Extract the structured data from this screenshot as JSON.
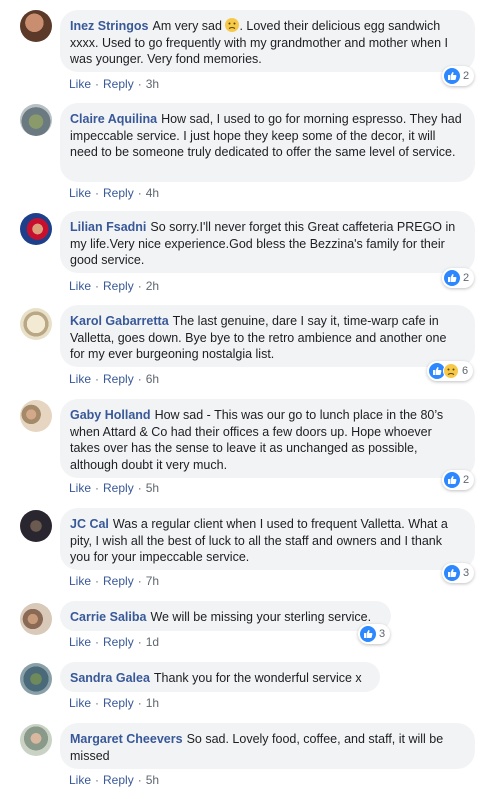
{
  "comments": [
    {
      "author": "Inez Stringos",
      "text": "Am very sad",
      "text_after": ". Loved their delicious egg sandwich xxxx. Used to go frequently with my grandmother and mother when I was younger. Very fond memories.",
      "time": "3h",
      "reaction_count": "2"
    },
    {
      "author": "Claire Aquilina",
      "text": "How sad, I used to go for morning espresso. They had impeccable service. I just hope they keep some of the decor, it will need to be someone truly dedicated to offer the same level of service.",
      "time": "4h"
    },
    {
      "author": "Lilian Fsadni",
      "text": "So sorry.I'll never forget this Great caffeteria PREGO in my life.Very nice experience.God bless the Bezzina's family for their good service.",
      "time": "2h",
      "reaction_count": "2"
    },
    {
      "author": "Karol Gabarretta",
      "text": "The last genuine, dare I say it, time-warp cafe in Valletta, goes down. Bye bye to the retro ambience and another one for my ever burgeoning nostalgia list.",
      "time": "6h",
      "reaction_count": "6"
    },
    {
      "author": "Gaby Holland",
      "text": "How sad - This was our go to lunch place in the 80’s when Attard & Co had their offices a few doors up. Hope whoever takes over has the sense to leave it as unchanged as possible, although doubt it very much.",
      "time": "5h",
      "reaction_count": "2"
    },
    {
      "author": "JC Cal",
      "text": "Was a regular client when I used to frequent Valletta. What a pity, I wish all the best of luck to all the staff and owners and I thank you for your impeccable service.",
      "time": "7h",
      "reaction_count": "3"
    },
    {
      "author": "Carrie Saliba",
      "text": "We will be missing your sterling service.",
      "time": "1d",
      "reaction_count": "3"
    },
    {
      "author": "Sandra Galea",
      "text": "Thank you for the wonderful service x",
      "time": "1h"
    },
    {
      "author": "Margaret Cheevers",
      "text": "So sad. Lovely food, coffee, and staff, it will be missed",
      "time": "5h"
    }
  ],
  "labels": {
    "like": "Like",
    "reply": "Reply",
    "dot": "·"
  },
  "colors": {
    "link": "#385898",
    "bubble": "#f2f3f5",
    "like_blue": "#2d88ff",
    "sad_yellow": "#f7c94b"
  }
}
